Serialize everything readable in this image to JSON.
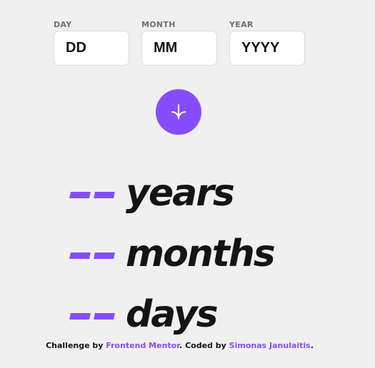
{
  "form": {
    "day": {
      "label": "DAY",
      "placeholder": "DD",
      "value": ""
    },
    "month": {
      "label": "MONTH",
      "placeholder": "MM",
      "value": ""
    },
    "year": {
      "label": "YEAR",
      "placeholder": "YYYY",
      "value": ""
    },
    "submit_icon": "arrow-down-icon"
  },
  "results": {
    "years": {
      "value": "--",
      "unit": "years"
    },
    "months": {
      "value": "--",
      "unit": "months"
    },
    "days": {
      "value": "--",
      "unit": "days"
    }
  },
  "attribution": {
    "challenge_prefix": "Challenge by",
    "challenge_link": "Frontend Mentor",
    "coded_prefix": ". Coded by",
    "coded_link": "Simonas Janulaitis",
    "suffix": "."
  },
  "colors": {
    "accent": "#854dff",
    "background": "#f0f0f0",
    "text": "#141414",
    "label": "#716f6f"
  }
}
